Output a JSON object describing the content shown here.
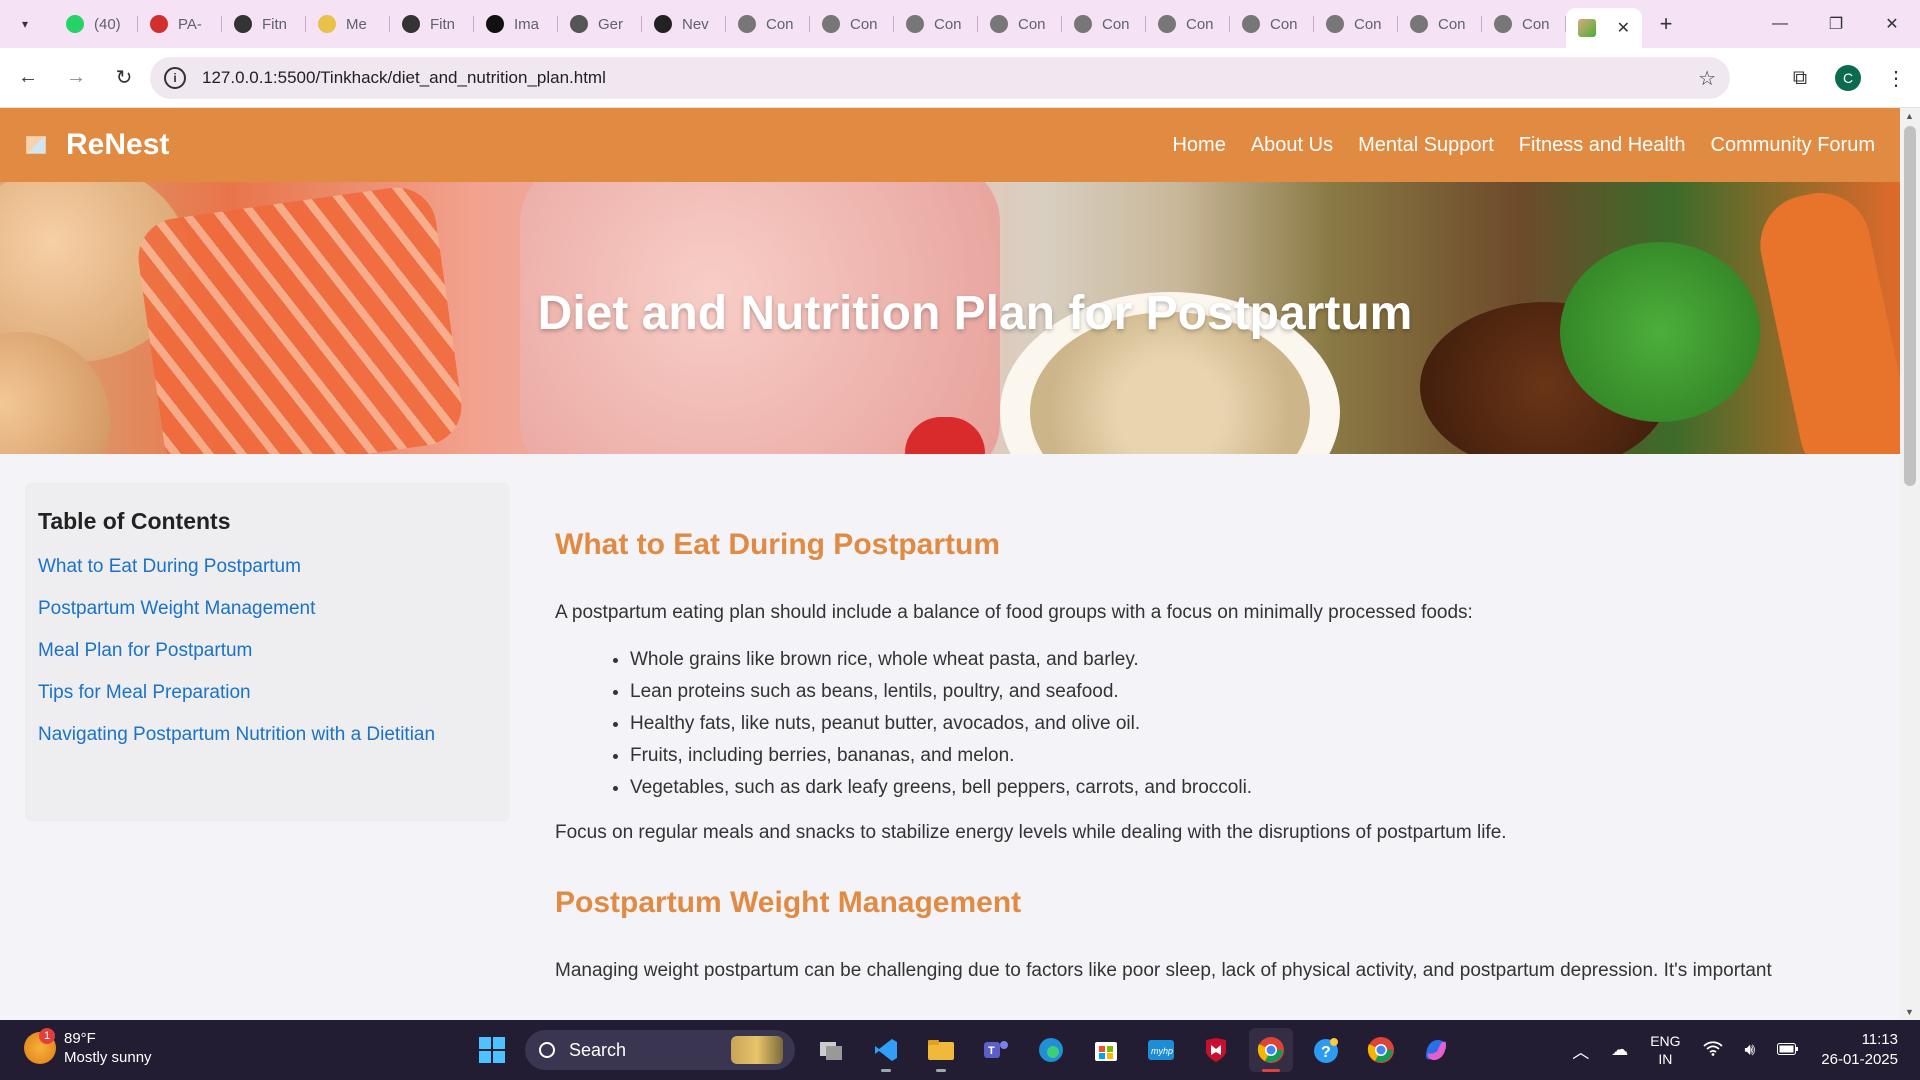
{
  "browser": {
    "tabs": [
      {
        "title": "(40)",
        "icon": "whatsapp-icon",
        "color": "#25d366"
      },
      {
        "title": "PA-",
        "icon": "pa-icon",
        "color": "#d32f2f"
      },
      {
        "title": "Fitn",
        "icon": "fitness-icon",
        "color": "#333333"
      },
      {
        "title": "Me",
        "icon": "mental-icon",
        "color": "#e8c04a"
      },
      {
        "title": "Fitn",
        "icon": "fitness-icon",
        "color": "#333333"
      },
      {
        "title": "Ima",
        "icon": "openai-icon",
        "color": "#111111"
      },
      {
        "title": "Ger",
        "icon": "github-icon",
        "color": "#555555"
      },
      {
        "title": "Nev",
        "icon": "new-icon",
        "color": "#222222"
      },
      {
        "title": "Con",
        "icon": "globe-icon",
        "color": "#777777"
      },
      {
        "title": "Con",
        "icon": "globe-icon",
        "color": "#777777"
      },
      {
        "title": "Con",
        "icon": "globe-icon",
        "color": "#777777"
      },
      {
        "title": "Con",
        "icon": "globe-icon",
        "color": "#777777"
      },
      {
        "title": "Con",
        "icon": "globe-icon",
        "color": "#777777"
      },
      {
        "title": "Con",
        "icon": "globe-icon",
        "color": "#777777"
      },
      {
        "title": "Con",
        "icon": "globe-icon",
        "color": "#777777"
      },
      {
        "title": "Con",
        "icon": "globe-icon",
        "color": "#777777"
      },
      {
        "title": "Con",
        "icon": "globe-icon",
        "color": "#777777"
      },
      {
        "title": "Con",
        "icon": "globe-icon",
        "color": "#777777"
      }
    ],
    "url": "127.0.0.1:5500/Tinkhack/diet_and_nutrition_plan.html",
    "profile_initial": "C"
  },
  "site": {
    "brand": "ReNest",
    "accent_color": "#e08a42",
    "nav": [
      "Home",
      "About Us",
      "Mental Support",
      "Fitness and Health",
      "Community Forum"
    ],
    "hero_title": "Diet and Nutrition Plan for Postpartum"
  },
  "toc": {
    "title": "Table of Contents",
    "items": [
      "What to Eat During Postpartum",
      "Postpartum Weight Management",
      "Meal Plan for Postpartum",
      "Tips for Meal Preparation",
      "Navigating Postpartum Nutrition with a Dietitian"
    ]
  },
  "content": {
    "section1": {
      "heading": "What to Eat During Postpartum",
      "intro": "A postpartum eating plan should include a balance of food groups with a focus on minimally processed foods:",
      "list": [
        "Whole grains like brown rice, whole wheat pasta, and barley.",
        "Lean proteins such as beans, lentils, poultry, and seafood.",
        "Healthy fats, like nuts, peanut butter, avocados, and olive oil.",
        "Fruits, including berries, bananas, and melon.",
        "Vegetables, such as dark leafy greens, bell peppers, carrots, and broccoli."
      ],
      "outro": "Focus on regular meals and snacks to stabilize energy levels while dealing with the disruptions of postpartum life."
    },
    "section2": {
      "heading": "Postpartum Weight Management",
      "text": "Managing weight postpartum can be challenging due to factors like poor sleep, lack of physical activity, and postpartum depression. It's important"
    }
  },
  "taskbar": {
    "weather_temp": "89°F",
    "weather_desc": "Mostly sunny",
    "weather_badge": "1",
    "search_label": "Search",
    "lang_line1": "ENG",
    "lang_line2": "IN",
    "time": "11:13",
    "date": "26-01-2025"
  }
}
